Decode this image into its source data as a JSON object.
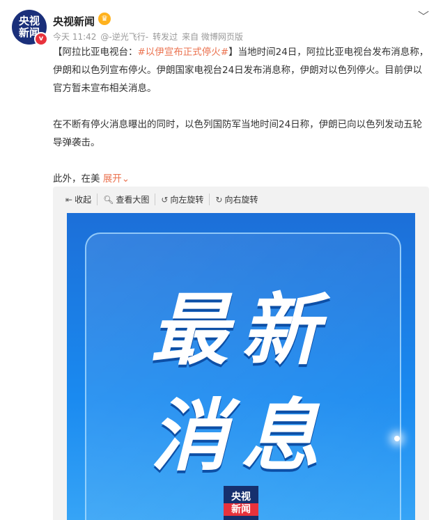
{
  "header": {
    "avatar_line1": "央视",
    "avatar_line2": "新闻",
    "verified_badge": "v",
    "username": "央视新闻",
    "crown_icon": "♛",
    "meta": {
      "time": "今天 11:42",
      "via": "@-逆光飞行-",
      "action": "转发过",
      "source": "来自 微博网页版"
    }
  },
  "post": {
    "para1_prefix": "【阿拉比亚电视台：",
    "topic": "#以伊宣布正式停火#",
    "para1_suffix": "】当地时间24日，阿拉比亚电视台发布消息称，伊朗和以色列宣布停火。伊朗国家电视台24日发布消息称，伊朗对以色列停火。目前伊以官方暂未宣布相关消息。",
    "para2": "在不断有停火消息曝出的同时，以色列国防军当地时间24日称，伊朗已向以色列发动五轮导弹袭击。",
    "para3_text": "此外，在美",
    "expand_label": "展开"
  },
  "image_toolbar": {
    "collapse": "收起",
    "view_large": "查看大图",
    "rotate_left": "向左旋转",
    "rotate_right": "向右旋转"
  },
  "poster": {
    "line1": "最新",
    "line2": "消息",
    "logo_line1": "央视",
    "logo_line2": "新闻"
  },
  "colors": {
    "topic": "#eb7350",
    "poster_blue": "#1a8af0"
  }
}
